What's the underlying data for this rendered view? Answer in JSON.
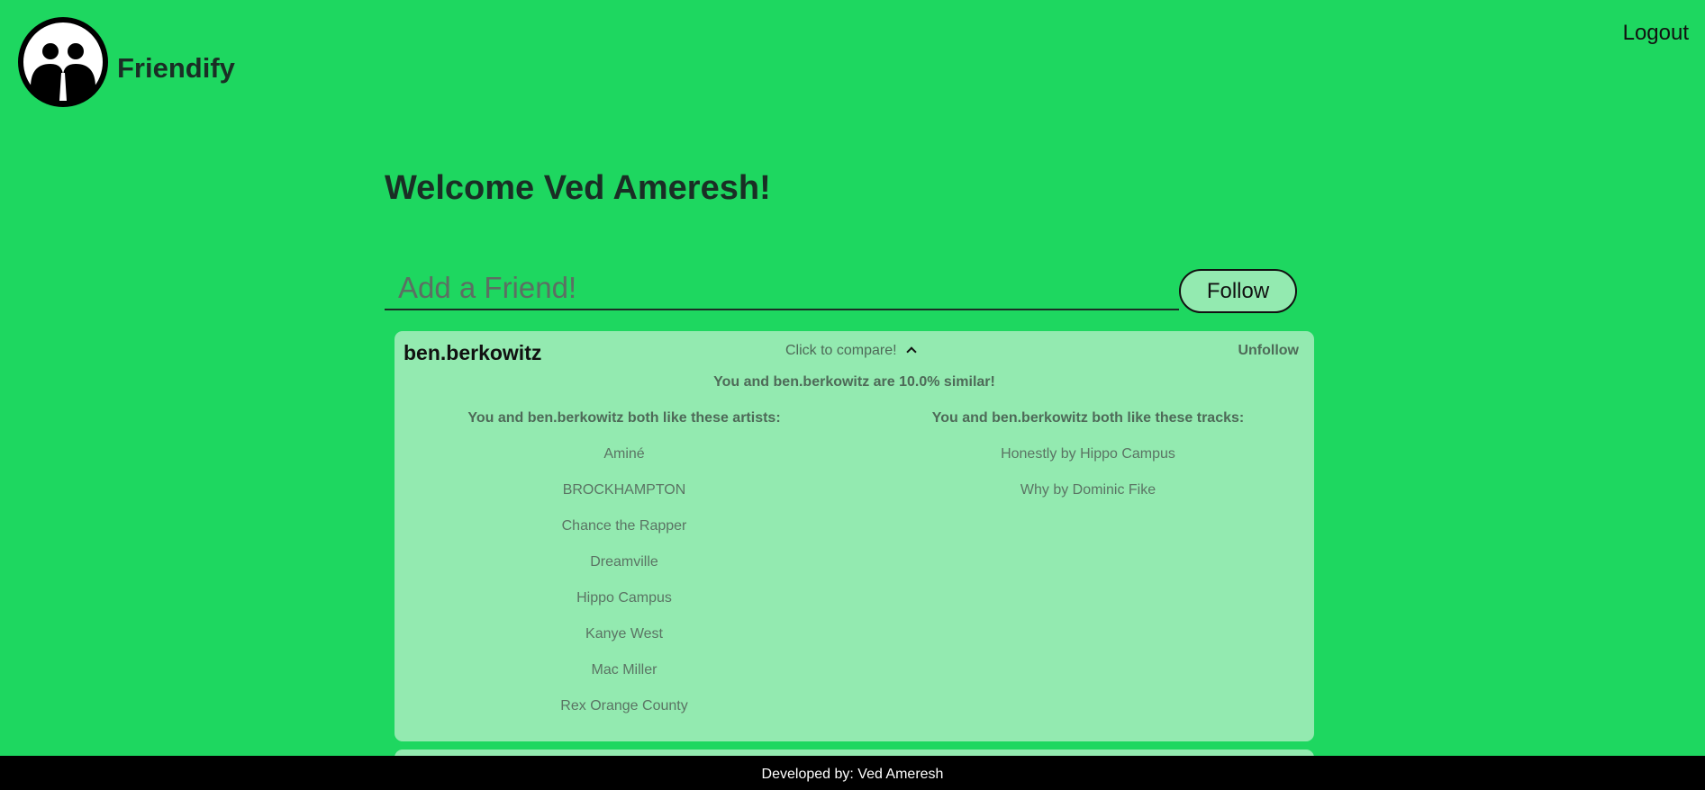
{
  "header": {
    "app_name": "Friendify",
    "logo_icon": "two-people-face-icon",
    "logout_label": "Logout"
  },
  "main": {
    "welcome": "Welcome Ved Ameresh!",
    "add_friend": {
      "placeholder": "Add a Friend!",
      "value": "",
      "follow_label": "Follow"
    },
    "friend_card": {
      "username": "ben.berkowitz",
      "compare_label": "Click to compare!",
      "compare_icon": "chevron-up-icon",
      "unfollow_label": "Unfollow",
      "similarity": "You and ben.berkowitz are 10.0% similar!",
      "artists_header": "You and ben.berkowitz both like these artists:",
      "artists": [
        "Aminé",
        "BROCKHAMPTON",
        "Chance the Rapper",
        "Dreamville",
        "Hippo Campus",
        "Kanye West",
        "Mac Miller",
        "Rex Orange County"
      ],
      "tracks_header": "You and ben.berkowitz both like these tracks:",
      "tracks": [
        "Honestly by Hippo Campus",
        "Why by Dominic Fike"
      ]
    }
  },
  "footer": {
    "credit": "Developed by: Ved Ameresh"
  },
  "colors": {
    "background": "#1ed760",
    "card": "#93eab0",
    "footer": "#000000"
  }
}
